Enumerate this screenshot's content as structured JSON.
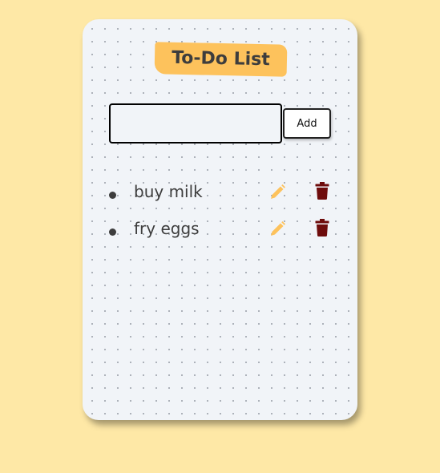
{
  "app": {
    "title": "To-Do List"
  },
  "input": {
    "value": "",
    "placeholder": ""
  },
  "add_button": {
    "label": "Add"
  },
  "tasks": [
    {
      "text": "buy milk",
      "edit_icon": "pencil-icon",
      "delete_icon": "trash-icon"
    },
    {
      "text": "fry eggs",
      "edit_icon": "pencil-icon",
      "delete_icon": "trash-icon"
    }
  ],
  "colors": {
    "page_background": "#fee8a6",
    "card_background": "#f1f4f8",
    "title_highlight": "#fdc25c",
    "edit_icon": "#fdc25c",
    "delete_icon": "#6e0c0c",
    "text": "#3d3d3d"
  }
}
